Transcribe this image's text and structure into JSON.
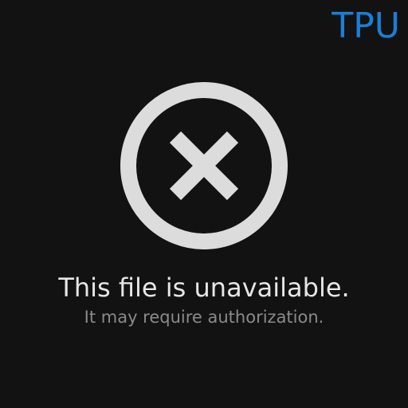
{
  "brand": {
    "logo_text": "TPU",
    "color": "#1a7fd6"
  },
  "error": {
    "icon": "close-circle-icon",
    "title": "This file is unavailable.",
    "subtitle": "It may require authorization.",
    "icon_color": "#dcdcdc"
  },
  "colors": {
    "background": "#121212",
    "title": "#e6e6e6",
    "subtitle": "#8a8a8a"
  }
}
